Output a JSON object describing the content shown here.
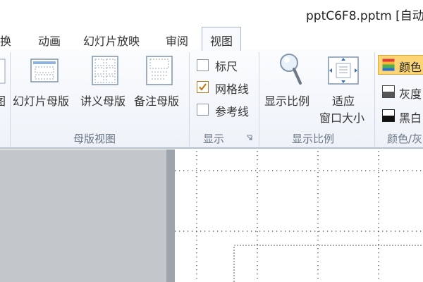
{
  "window": {
    "title": "pptC6F8.pptm [自动"
  },
  "tabs": [
    {
      "label": "切换",
      "active": false
    },
    {
      "label": "动画",
      "active": false
    },
    {
      "label": "幻灯片放映",
      "active": false
    },
    {
      "label": "审阅",
      "active": false
    },
    {
      "label": "视图",
      "active": true
    }
  ],
  "ribbon": {
    "master_views": {
      "group_label": "母版视图",
      "buttons": [
        {
          "label": "幻灯片母版"
        },
        {
          "label": "讲义母版"
        },
        {
          "label": "备注母版"
        }
      ]
    },
    "show": {
      "group_label": "显示",
      "checkboxes": [
        {
          "label": "标尺",
          "checked": false
        },
        {
          "label": "网格线",
          "checked": true
        },
        {
          "label": "参考线",
          "checked": false
        }
      ]
    },
    "zoom": {
      "group_label": "显示比例",
      "zoom_label": "显示比例",
      "fit_label_1": "适应",
      "fit_label_2": "窗口大小"
    },
    "color": {
      "group_label": "颜色/灰",
      "items": [
        {
          "label": "颜色",
          "selected": true
        },
        {
          "label": "灰度",
          "selected": false
        },
        {
          "label": "黑白",
          "selected": false
        }
      ]
    }
  },
  "colors": {
    "accent": "#fcd575",
    "side_panel": "#c3c7cc",
    "grid_dots": "#444444"
  }
}
